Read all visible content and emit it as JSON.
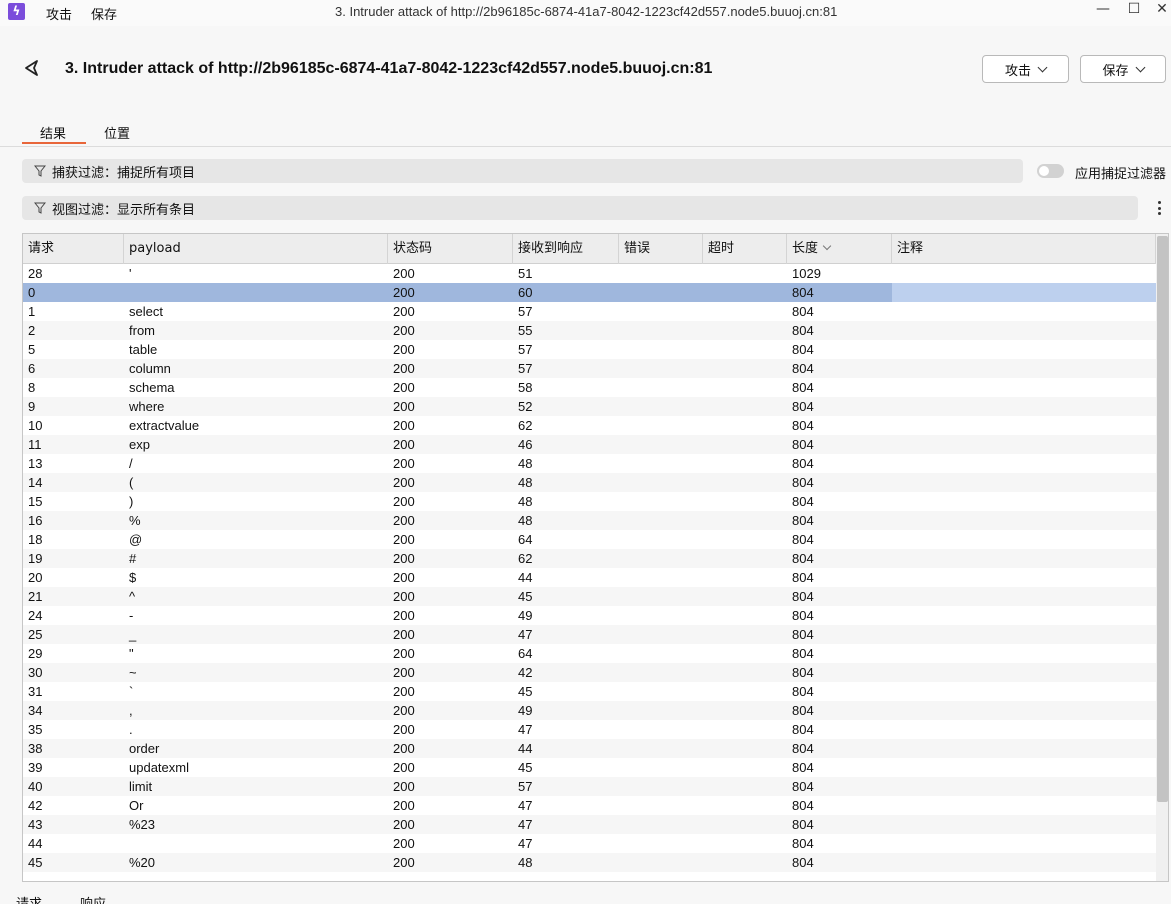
{
  "menu": {
    "attack": "攻击",
    "save": "保存"
  },
  "window": {
    "title": "3. Intruder attack of http://2b96185c-6874-41a7-8042-1223cf42d557.node5.buuoj.cn:81",
    "minimize": "—",
    "maximize": "☐",
    "close": "✕"
  },
  "header": {
    "title": "3. Intruder attack of http://2b96185c-6874-41a7-8042-1223cf42d557.node5.buuoj.cn:81",
    "attack_btn": "攻击",
    "save_btn": "保存"
  },
  "tabs": [
    {
      "label": "结果",
      "active": true
    },
    {
      "label": "位置",
      "active": false
    }
  ],
  "capture_filter": {
    "text": "捕获过滤：捕捉所有项目",
    "toggle_label": "应用捕捉过滤器"
  },
  "view_filter": {
    "text": "视图过滤：显示所有条目"
  },
  "table": {
    "columns": [
      "请求",
      "payload",
      "状态码",
      "接收到响应",
      "错误",
      "超时",
      "长度",
      "注释"
    ],
    "sorted_column": "长度",
    "selected_row_index": 1,
    "rows": [
      [
        "28",
        "'",
        "200",
        "51",
        "",
        "",
        "1029",
        ""
      ],
      [
        "0",
        "",
        "200",
        "60",
        "",
        "",
        "804",
        ""
      ],
      [
        "1",
        "select",
        "200",
        "57",
        "",
        "",
        "804",
        ""
      ],
      [
        "2",
        "from",
        "200",
        "55",
        "",
        "",
        "804",
        ""
      ],
      [
        "5",
        "table",
        "200",
        "57",
        "",
        "",
        "804",
        ""
      ],
      [
        "6",
        "column",
        "200",
        "57",
        "",
        "",
        "804",
        ""
      ],
      [
        "8",
        "schema",
        "200",
        "58",
        "",
        "",
        "804",
        ""
      ],
      [
        "9",
        "where",
        "200",
        "52",
        "",
        "",
        "804",
        ""
      ],
      [
        "10",
        "extractvalue",
        "200",
        "62",
        "",
        "",
        "804",
        ""
      ],
      [
        "11",
        "exp",
        "200",
        "46",
        "",
        "",
        "804",
        ""
      ],
      [
        "13",
        "/",
        "200",
        "48",
        "",
        "",
        "804",
        ""
      ],
      [
        "14",
        "(",
        "200",
        "48",
        "",
        "",
        "804",
        ""
      ],
      [
        "15",
        ")",
        "200",
        "48",
        "",
        "",
        "804",
        ""
      ],
      [
        "16",
        "%",
        "200",
        "48",
        "",
        "",
        "804",
        ""
      ],
      [
        "18",
        "@",
        "200",
        "64",
        "",
        "",
        "804",
        ""
      ],
      [
        "19",
        "#",
        "200",
        "62",
        "",
        "",
        "804",
        ""
      ],
      [
        "20",
        "$",
        "200",
        "44",
        "",
        "",
        "804",
        ""
      ],
      [
        "21",
        "^",
        "200",
        "45",
        "",
        "",
        "804",
        ""
      ],
      [
        "24",
        "-",
        "200",
        "49",
        "",
        "",
        "804",
        ""
      ],
      [
        "25",
        "_",
        "200",
        "47",
        "",
        "",
        "804",
        ""
      ],
      [
        "29",
        "\"",
        "200",
        "64",
        "",
        "",
        "804",
        ""
      ],
      [
        "30",
        "~",
        "200",
        "42",
        "",
        "",
        "804",
        ""
      ],
      [
        "31",
        "`",
        "200",
        "45",
        "",
        "",
        "804",
        ""
      ],
      [
        "34",
        ",",
        "200",
        "49",
        "",
        "",
        "804",
        ""
      ],
      [
        "35",
        ".",
        "200",
        "47",
        "",
        "",
        "804",
        ""
      ],
      [
        "38",
        "order",
        "200",
        "44",
        "",
        "",
        "804",
        ""
      ],
      [
        "39",
        "updatexml",
        "200",
        "45",
        "",
        "",
        "804",
        ""
      ],
      [
        "40",
        "limit",
        "200",
        "57",
        "",
        "",
        "804",
        ""
      ],
      [
        "42",
        "Or",
        "200",
        "47",
        "",
        "",
        "804",
        ""
      ],
      [
        "43",
        "%23",
        "200",
        "47",
        "",
        "",
        "804",
        ""
      ],
      [
        "44",
        "",
        "200",
        "47",
        "",
        "",
        "804",
        ""
      ],
      [
        "45",
        "%20",
        "200",
        "48",
        "",
        "",
        "804",
        ""
      ]
    ]
  },
  "bottom_tabs": [
    "请求",
    "响应"
  ]
}
